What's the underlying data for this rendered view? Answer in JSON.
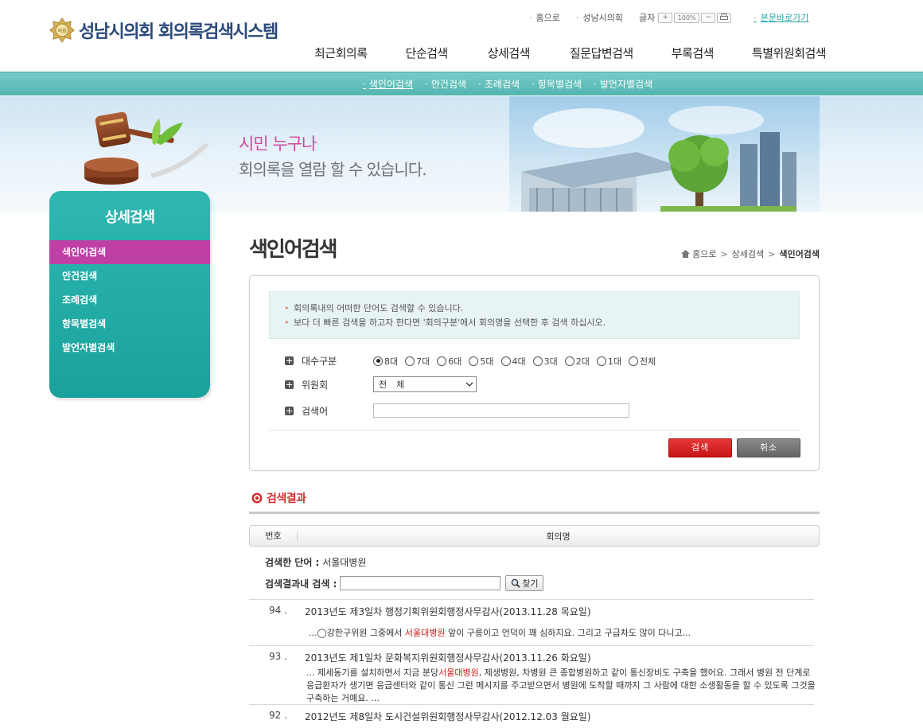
{
  "header": {
    "logo_text": "성남시의회 회의록검색시스템",
    "seal_text": "의회",
    "util": {
      "home": "홈으로",
      "council": "성남시의회",
      "font_label": "글자",
      "zoom": "100%",
      "skip": "본문바로가기"
    },
    "gnb": [
      "최근회의록",
      "단순검색",
      "상세검색",
      "질문답변검색",
      "부록검색",
      "특별위원회검색"
    ],
    "subnav": [
      "색인어검색",
      "안건검색",
      "조례검색",
      "항목별검색",
      "발언자별검색"
    ]
  },
  "banner": {
    "slogan_line1": "시민 누구나",
    "slogan_line2": "회의록을 열람 할 수 있습니다."
  },
  "sidebar": {
    "title": "상세검색",
    "items": [
      "색인어검색",
      "안건검색",
      "조례검색",
      "항목별검색",
      "발언자별검색"
    ],
    "active_index": 0
  },
  "main": {
    "page_title": "색인어검색",
    "breadcrumb": {
      "home": "홈으로",
      "section": "상세검색",
      "current": "색인어검색",
      "sep": ">"
    },
    "notice": [
      "회의록내의 어떠한 단어도 검색할 수 있습니다.",
      "보다 더 빠른 검색을 하고자 한다면 '회의구분'에서 회의명을 선택한 후 검색 하십시오."
    ],
    "form": {
      "era_label": "대수구분",
      "era_options": [
        "8대",
        "7대",
        "6대",
        "5대",
        "4대",
        "3대",
        "2대",
        "1대",
        "전체"
      ],
      "era_selected": "8대",
      "committee_label": "위원회",
      "committee_value": "전체",
      "keyword_label": "검색어",
      "keyword_value": "",
      "search_button": "검색",
      "cancel_button": "취소"
    },
    "results": {
      "heading": "검색결과",
      "col_no": "번호",
      "col_name": "회의명",
      "searched_label": "검색한 단어 :",
      "searched_word": "서울대병원",
      "within_label": "검색결과내 검색 :",
      "within_value": "",
      "find_button": "찾기",
      "items": [
        {
          "no": "94 .",
          "title": "2013년도 제3일차 행정기획위원회행정사무감사(2013.11.28 목요일)",
          "snippet_before": "...◯강한구위원 그중에서 ",
          "snippet_hit": "서울대병원",
          "snippet_after": " 앞이 구릉이고 언덕이 꽤 심하지요. 그리고 구급차도 많이 다니고..."
        },
        {
          "no": "93 .",
          "title": "2013년도 제1일차 문화복지위원회행정사무감사(2013.11.26 화요일)",
          "snippet_before": "... 제세동기를 설치하면서 지금 분당",
          "snippet_hit": "서울대병원",
          "snippet_after": ", 제생병원, 차병원 큰 종합병원하고 같이 통신장비도 구축을 했어요. 그래서 병원 전 단계로 응급환자가 생기면 응급센터와 같이 통신 그런 메시지를 주고받으면서 병원에 도착할 때까지 그 사람에 대한 소생활동을 할 수 있도록 그것을 구축하는 거예요. ..."
        },
        {
          "no": "92 .",
          "title": "2012년도 제8일차 도시건설위원회행정사무감사(2012.12.03 월요일)"
        }
      ]
    }
  },
  "colors": {
    "teal": "#1fa9a3",
    "magenta_active": "#bf3fa6",
    "highlight_red": "#d11a1a",
    "search_red": "#d42121"
  },
  "icons": [
    "seal-logo-icon",
    "home-icon",
    "plus-icon",
    "radio-icon",
    "chevron-down-icon",
    "target-icon",
    "magnify-icon",
    "print-icon"
  ]
}
